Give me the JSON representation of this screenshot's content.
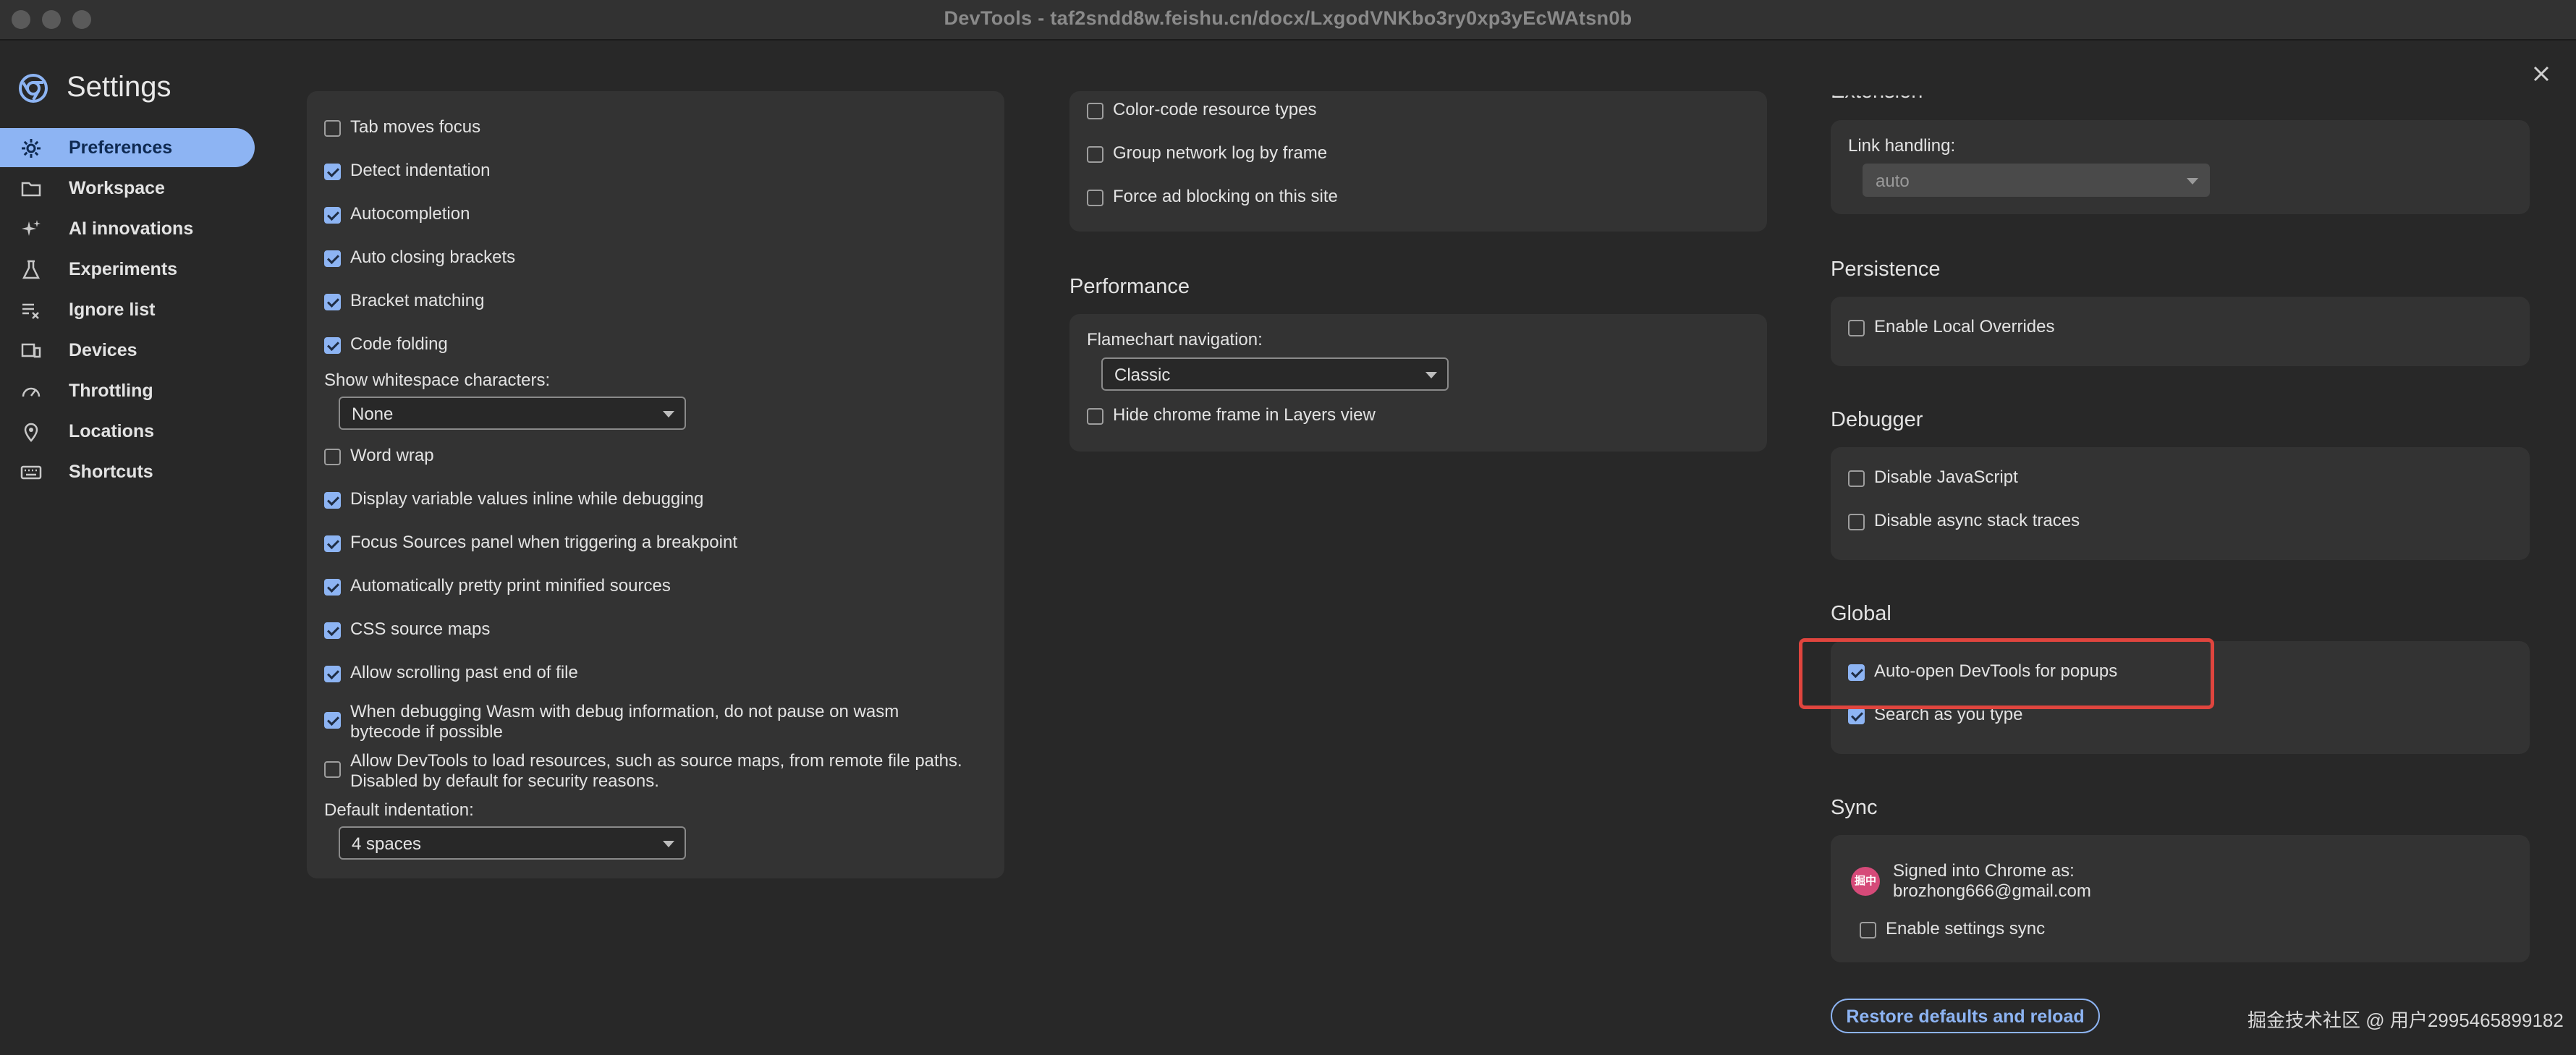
{
  "window": {
    "title": "DevTools - taf2sndd8w.feishu.cn/docx/LxgodVNKbo3ry0xp3yEcWAtsn0b"
  },
  "settings": {
    "title": "Settings"
  },
  "sidebar": {
    "items": [
      {
        "label": "Preferences",
        "icon": "gear-icon",
        "active": true
      },
      {
        "label": "Workspace",
        "icon": "folder-icon",
        "active": false
      },
      {
        "label": "AI innovations",
        "icon": "sparkle-icon",
        "active": false
      },
      {
        "label": "Experiments",
        "icon": "flask-icon",
        "active": false
      },
      {
        "label": "Ignore list",
        "icon": "list-exclude-icon",
        "active": false
      },
      {
        "label": "Devices",
        "icon": "devices-icon",
        "active": false
      },
      {
        "label": "Throttling",
        "icon": "gauge-icon",
        "active": false
      },
      {
        "label": "Locations",
        "icon": "location-pin-icon",
        "active": false
      },
      {
        "label": "Shortcuts",
        "icon": "keyboard-icon",
        "active": false
      }
    ]
  },
  "sources": {
    "checkboxes": [
      {
        "label": "Tab moves focus",
        "checked": false
      },
      {
        "label": "Detect indentation",
        "checked": true
      },
      {
        "label": "Autocompletion",
        "checked": true
      },
      {
        "label": "Auto closing brackets",
        "checked": true
      },
      {
        "label": "Bracket matching",
        "checked": true
      },
      {
        "label": "Code folding",
        "checked": true
      }
    ],
    "whitespace_label": "Show whitespace characters:",
    "whitespace_value": "None",
    "checkboxes2": [
      {
        "label": "Word wrap",
        "checked": false
      },
      {
        "label": "Display variable values inline while debugging",
        "checked": true
      },
      {
        "label": "Focus Sources panel when triggering a breakpoint",
        "checked": true
      },
      {
        "label": "Automatically pretty print minified sources",
        "checked": true
      },
      {
        "label": "CSS source maps",
        "checked": true
      },
      {
        "label": "Allow scrolling past end of file",
        "checked": true
      },
      {
        "label": "When debugging Wasm with debug information, do not pause on wasm bytecode if possible",
        "checked": true
      },
      {
        "label": "Allow DevTools to load resources, such as source maps, from remote file paths. Disabled by default for security reasons.",
        "checked": false
      }
    ],
    "indentation_label": "Default indentation:",
    "indentation_value": "4 spaces"
  },
  "network": {
    "checkboxes": [
      {
        "label": "Color-code resource types",
        "checked": false
      },
      {
        "label": "Group network log by frame",
        "checked": false
      },
      {
        "label": "Force ad blocking on this site",
        "checked": false
      }
    ]
  },
  "performance": {
    "title": "Performance",
    "flamechart_label": "Flamechart navigation:",
    "flamechart_value": "Classic",
    "hide_chrome_frame": {
      "label": "Hide chrome frame in Layers view",
      "checked": false
    }
  },
  "extension": {
    "title": "Extension",
    "link_handling_label": "Link handling:",
    "link_handling_value": "auto"
  },
  "persistence": {
    "title": "Persistence",
    "local_overrides": {
      "label": "Enable Local Overrides",
      "checked": false
    }
  },
  "debugger": {
    "title": "Debugger",
    "checkboxes": [
      {
        "label": "Disable JavaScript",
        "checked": false
      },
      {
        "label": "Disable async stack traces",
        "checked": false
      }
    ]
  },
  "global": {
    "title": "Global",
    "checkboxes": [
      {
        "label": "Auto-open DevTools for popups",
        "checked": true
      },
      {
        "label": "Search as you type",
        "checked": true
      }
    ]
  },
  "sync": {
    "title": "Sync",
    "avatar_text": "掘中",
    "signed_in_label": "Signed into Chrome as:",
    "email": "brozhong666@gmail.com",
    "enable_sync": {
      "label": "Enable settings sync",
      "checked": false
    }
  },
  "actions": {
    "restore_label": "Restore defaults and reload"
  },
  "watermark": "掘金技术社区 @ 用户2995465899182",
  "colors": {
    "accent": "#8db4f3",
    "highlight": "#e0453e",
    "background": "#282828",
    "card": "#333333"
  }
}
